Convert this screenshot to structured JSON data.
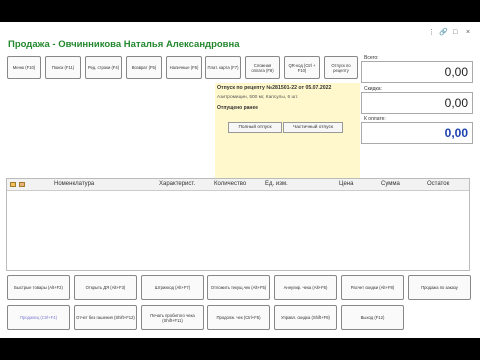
{
  "window": {
    "title": "Продажа - Овчинникова Наталья Александровна",
    "controls": [
      "⋮",
      "🔗",
      "□",
      "×"
    ]
  },
  "toolbar": [
    {
      "label": "Меню (F10)"
    },
    {
      "label": "Поиск (F11)"
    },
    {
      "label": "Ред. строки (F4)"
    },
    {
      "label": "Возврат (F5)"
    },
    {
      "label": "Наличные (F6)"
    },
    {
      "label": "Плат. карта (F7)"
    },
    {
      "label": "Сложная оплата (F8)"
    },
    {
      "label": "QR-код (Ctrl + F10)"
    },
    {
      "label": "Отпуск по рецепту"
    }
  ],
  "totals": {
    "total_label": "Всего:",
    "total_value": "0,00",
    "discount_label": "Скидка:",
    "discount_value": "0,00",
    "pay_label": "К оплате:",
    "pay_value": "0,00"
  },
  "prescription": {
    "title": "Отпуск по рецепту №281501-22 от 05.07.2022",
    "medicine": "Азитромицин, 500 мг, Капсулы, 6 шт.",
    "status": "Отпущено ранее",
    "full_label": "Полный отпуск",
    "partial_label": "Частичный отпуск"
  },
  "table": {
    "columns": [
      "Номенклатура",
      "Характерист.",
      "Количество",
      "Ед. изм.",
      "Цена",
      "Сумма",
      "Остаток"
    ],
    "icons": [
      "folder-icon",
      "list-icon"
    ]
  },
  "bottom_row1": [
    {
      "label": "Быстрые товары (Alt+F2)"
    },
    {
      "label": "Открыть ДЯ (Alt+F3)"
    },
    {
      "label": "Штрихкод (Alt+F7)"
    },
    {
      "label": "Отложить текущ.чек (Alt+F5)"
    },
    {
      "label": "Аннулир. чека (Alt+F6)"
    },
    {
      "label": "Расчет скидки (Alt+F8)"
    },
    {
      "label": "Продажа по заказу"
    }
  ],
  "bottom_row2": [
    {
      "label": "Продавец (Ctrl+F4)"
    },
    {
      "label": "Отчет без гашения (Shift+F12)"
    },
    {
      "label": "Печать пробитого чека (Shift+F11)"
    },
    {
      "label": "Продолж. чек (Ctrl+F5)"
    },
    {
      "label": "Управл. скидка (Shift+F8)"
    },
    {
      "label": "Выход (F12)"
    }
  ]
}
